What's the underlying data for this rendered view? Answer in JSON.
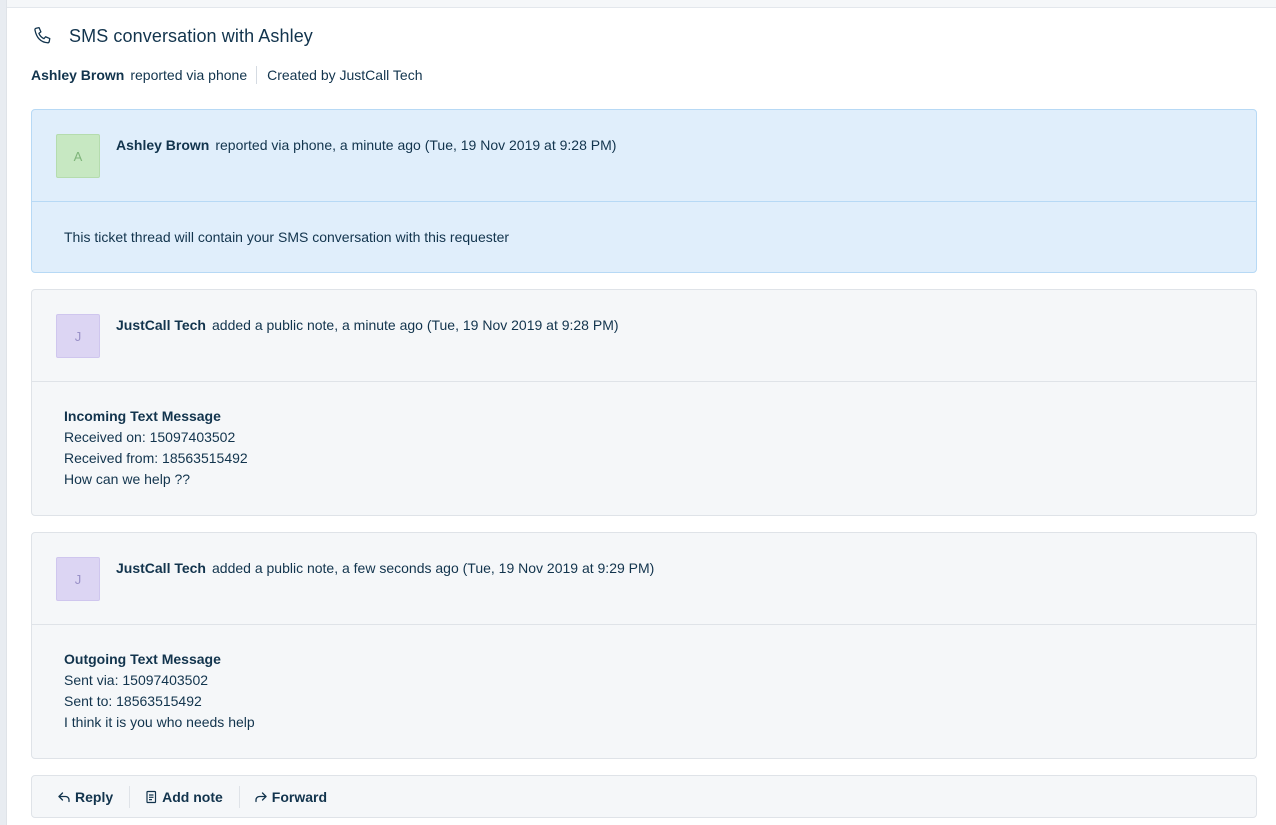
{
  "ticket": {
    "title": "SMS conversation with Ashley",
    "requester": "Ashley Brown",
    "source_text": "reported via phone",
    "created_by": "Created by JustCall Tech"
  },
  "conversations": [
    {
      "avatar_letter": "A",
      "author": "Ashley Brown",
      "action": "reported via phone, a minute ago (Tue, 19 Nov 2019 at 9:28 PM)",
      "body": [
        "This ticket thread will contain your SMS conversation with this requester"
      ]
    },
    {
      "avatar_letter": "J",
      "author": "JustCall Tech",
      "action": "added a public note, a minute ago (Tue, 19 Nov 2019 at 9:28 PM)",
      "heading": "Incoming Text Message",
      "body": [
        "Received on: 15097403502",
        "Received from: 18563515492",
        "How can we help ??"
      ]
    },
    {
      "avatar_letter": "J",
      "author": "JustCall Tech",
      "action": "added a public note, a few seconds ago (Tue, 19 Nov 2019 at 9:29 PM)",
      "heading": "Outgoing Text Message",
      "body": [
        "Sent via: 15097403502",
        "Sent to: 18563515492",
        "I think it is you who needs help"
      ]
    }
  ],
  "actions": {
    "reply": "Reply",
    "add_note": "Add note",
    "forward": "Forward"
  },
  "icons": {
    "header": "phone-icon",
    "reply": "reply-icon",
    "add_note": "note-icon",
    "forward": "forward-icon"
  },
  "colors": {
    "text": "#12344d",
    "requester_card_bg": "#e0eefb",
    "note_card_bg": "#f5f7f9",
    "avatar_green": "#c7e8c2",
    "avatar_purple": "#dcd5f3"
  }
}
